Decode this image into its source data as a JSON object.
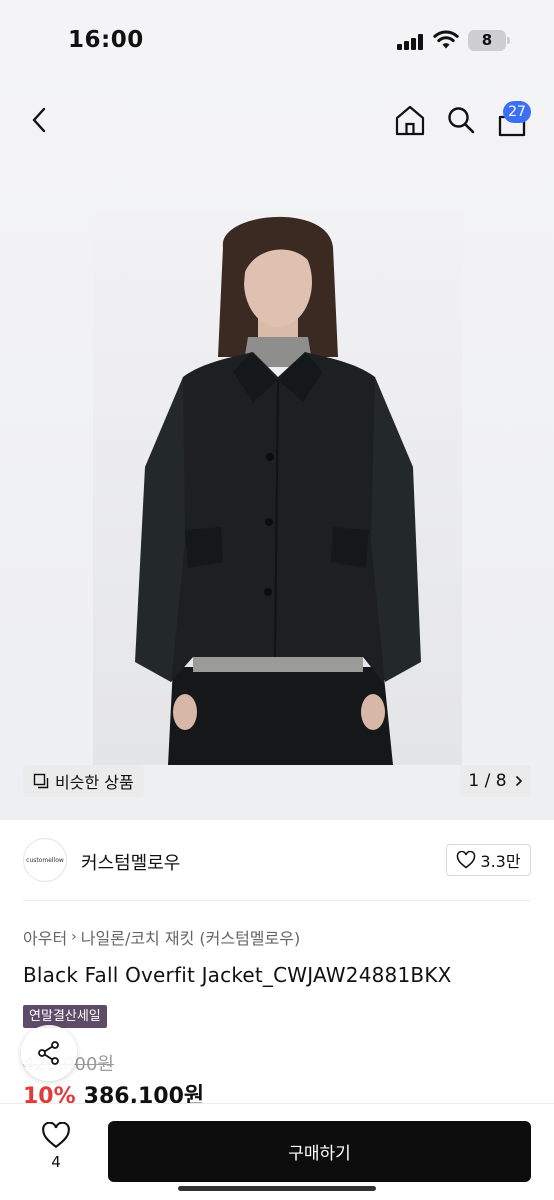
{
  "status_bar": {
    "time": "16:00",
    "battery": "8"
  },
  "nav": {
    "cart_count": "27",
    "icons": [
      "back-icon",
      "home-icon",
      "search-icon",
      "cart-icon"
    ]
  },
  "gallery": {
    "similar_label": "비슷한 상품",
    "pager": "1 / 8"
  },
  "brand": {
    "logo_text": "customellow",
    "name": "커스텀멜로우",
    "likes": "3.3만"
  },
  "product": {
    "breadcrumb": [
      "아우터",
      "나일론/코치 재킷 (커스텀멜로우)"
    ],
    "title": "Black Fall Overfit Jacket_CWJAW24881BKX",
    "sale_badge": "연말결산세일",
    "original_price": "429,000원",
    "discount": "10%",
    "price": "386,100원"
  },
  "bottom_bar": {
    "wish_count": "4",
    "buy_label": "구매하기"
  },
  "colors": {
    "badge_blue": "#3b6ff5",
    "sale_badge": "#5e4b68",
    "discount_red": "#e23b3b",
    "buy_button": "#0d0d0d"
  }
}
